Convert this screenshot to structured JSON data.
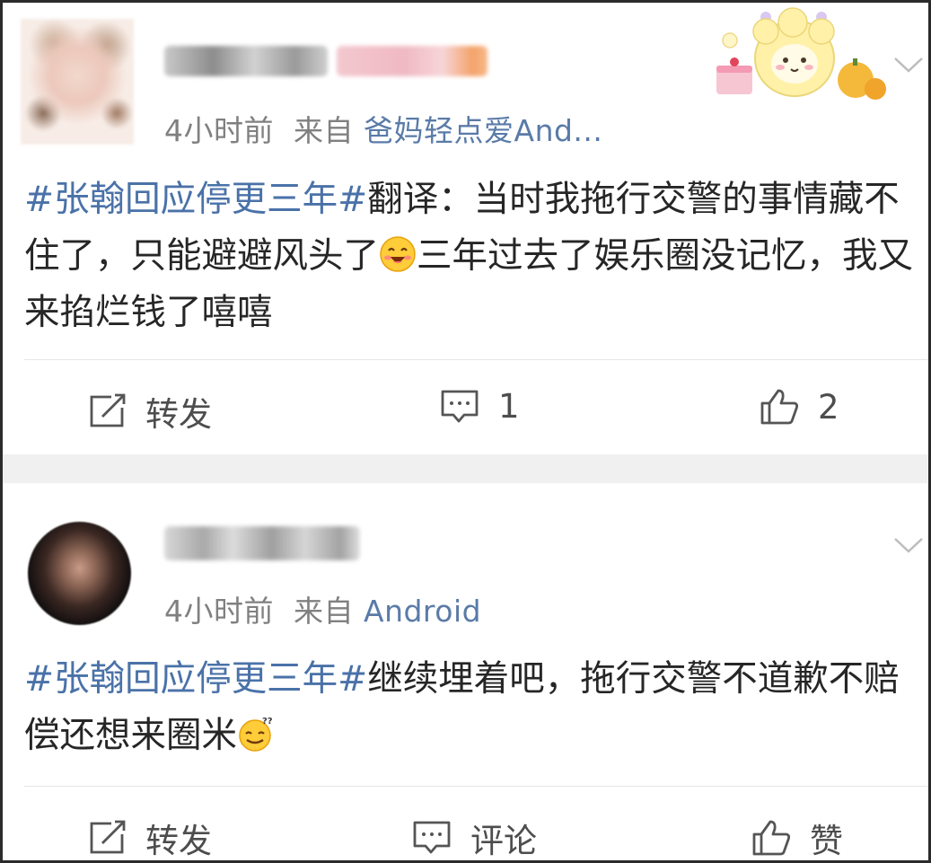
{
  "posts": [
    {
      "time": "4小时前",
      "source_prefix": "来自",
      "source": "爸妈轻点爱And...",
      "hashtag": "#张翰回应停更三年#",
      "text_part1": "翻译：当时我拖行交警的事情藏不住了，只能避避风头了",
      "emoji": "grinning-face-emoji",
      "text_part2": "三年过去了娱乐圈没记忆，我又来掐烂钱了嘻嘻",
      "repost_label": "转发",
      "comment_label": "1",
      "like_label": "2"
    },
    {
      "time": "4小时前",
      "source_prefix": "来自",
      "source": "Android",
      "hashtag": "#张翰回应停更三年#",
      "text_part1": "继续埋着吧，拖行交警不道歉不赔偿还想来圈米",
      "emoji": "confused-face-emoji",
      "repost_label": "转发",
      "comment_label": "评论",
      "like_label": "赞"
    }
  ],
  "colors": {
    "link": "#4a72a8",
    "source": "#5a7ba8",
    "meta": "#808080",
    "text": "#262626",
    "separator": "#f0f0f0"
  }
}
